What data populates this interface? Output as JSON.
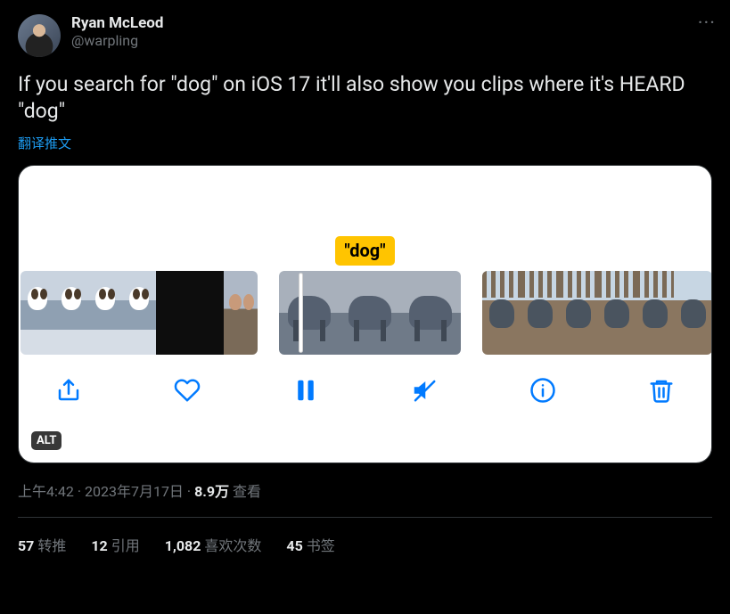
{
  "author": {
    "name": "Ryan McLeod",
    "handle": "@warpling"
  },
  "tweet_text": "If you search for \"dog\" on iOS 17 it'll also show you clips where it's HEARD \"dog\"",
  "translate_label": "翻译推文",
  "media": {
    "highlight_label": "\"dog\"",
    "alt_badge": "ALT"
  },
  "meta": {
    "time": "上午4:42",
    "dot": " · ",
    "date": "2023年7月17日",
    "views_count": "8.9万",
    "views_label": " 查看"
  },
  "stats": {
    "retweets_count": "57",
    "retweets_label": "转推",
    "quotes_count": "12",
    "quotes_label": "引用",
    "likes_count": "1,082",
    "likes_label": "喜欢次数",
    "bookmarks_count": "45",
    "bookmarks_label": "书签"
  }
}
